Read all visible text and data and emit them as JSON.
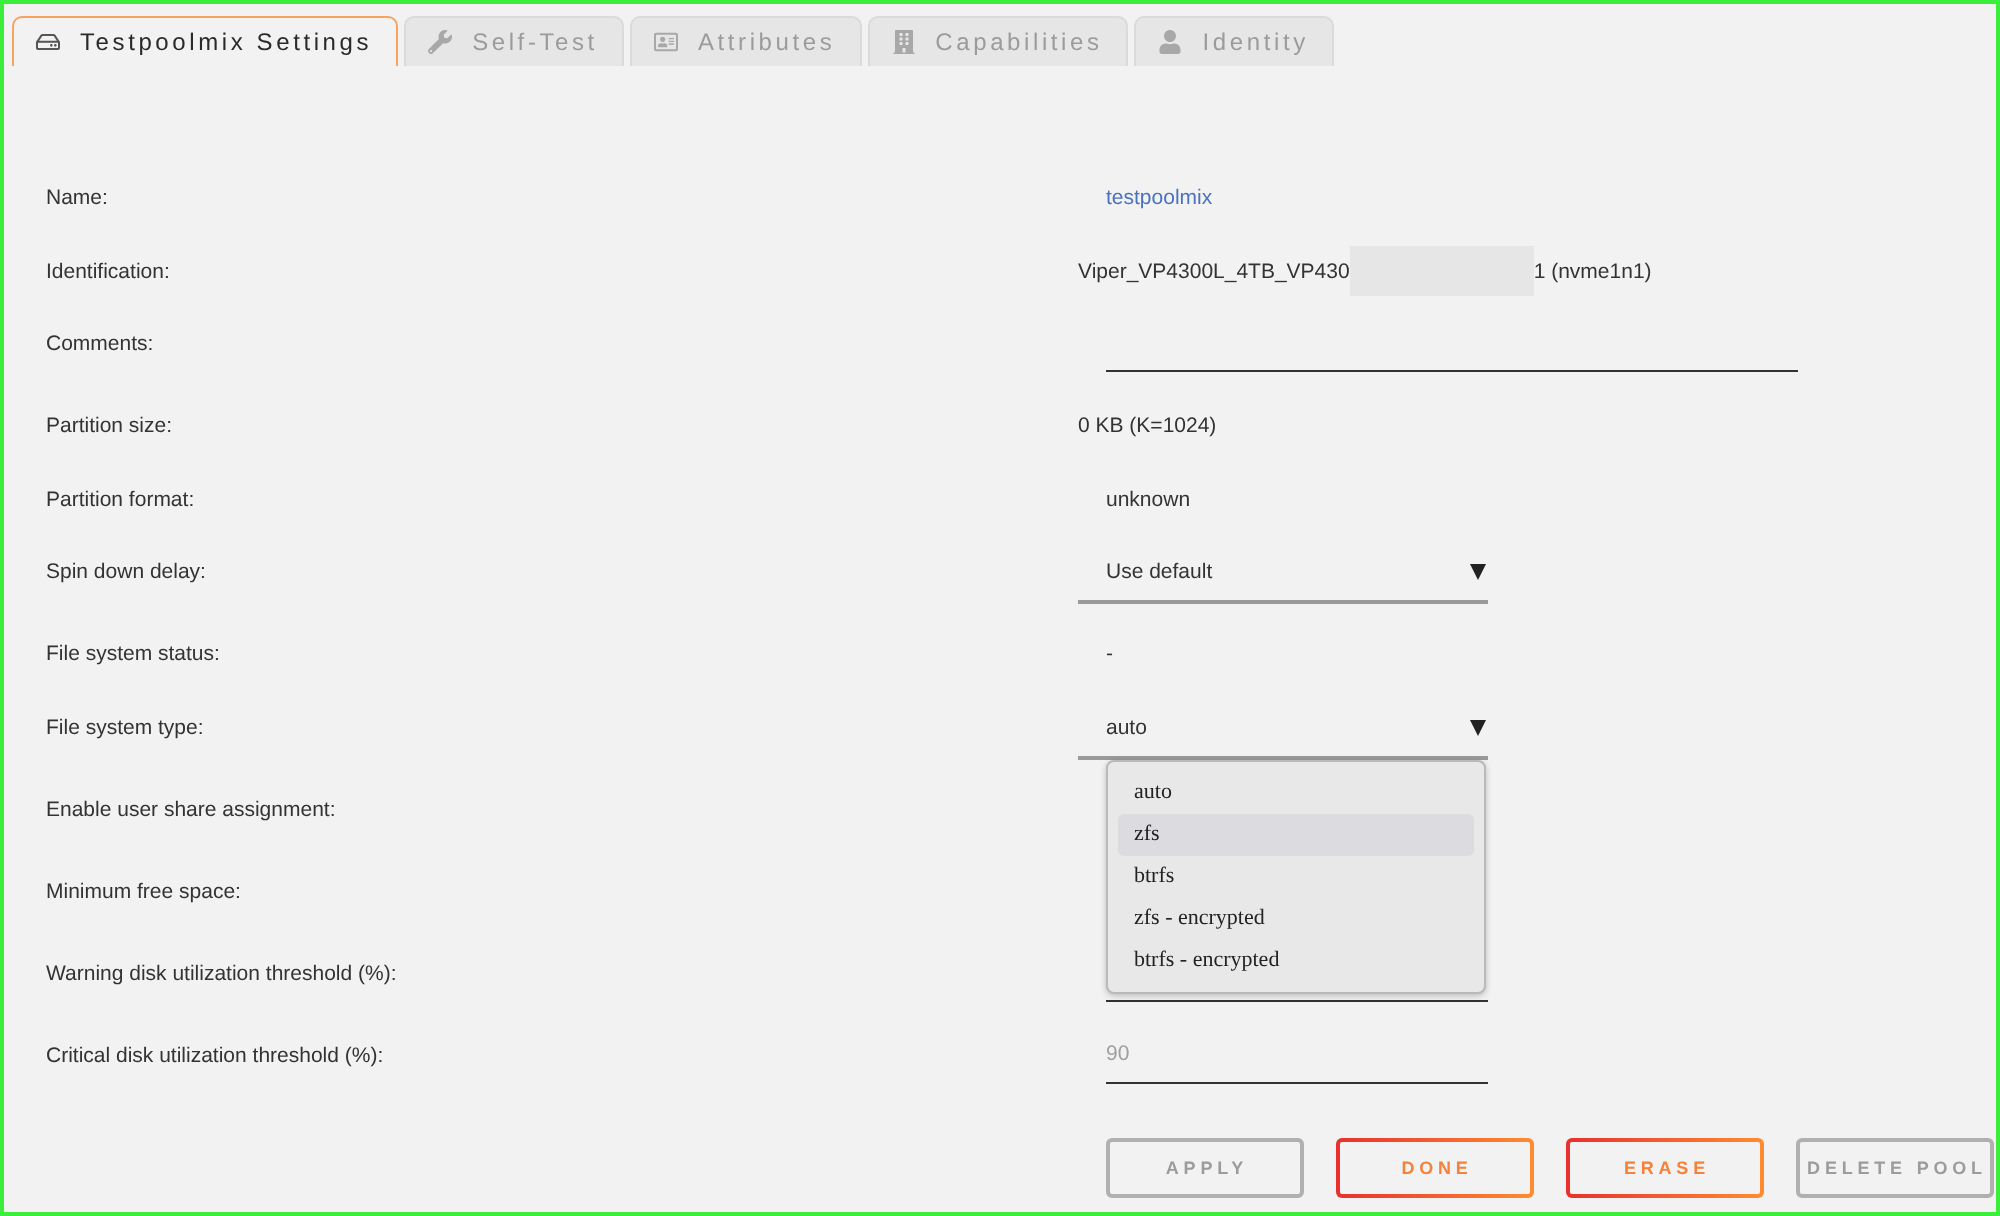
{
  "tabs": [
    {
      "label": "Testpoolmix Settings",
      "selected": true
    },
    {
      "label": "Self-Test",
      "selected": false
    },
    {
      "label": "Attributes",
      "selected": false
    },
    {
      "label": "Capabilities",
      "selected": false
    },
    {
      "label": "Identity",
      "selected": false
    }
  ],
  "fields": [
    {
      "label": "Name:",
      "kind": "link",
      "value": "testpoolmix"
    },
    {
      "label": "Identification:",
      "kind": "identifier",
      "value": "Viper_VP4300L_4TB_VP430",
      "suffix": "1 (nvme1n1)",
      "redacted": true
    },
    {
      "label": "Comments:",
      "kind": "input"
    },
    {
      "label": "Partition size:",
      "kind": "text",
      "value": "0 KB (K=1024)"
    },
    {
      "label": "Partition format:",
      "kind": "status",
      "value": "unknown"
    },
    {
      "label": "Spin down delay:",
      "kind": "select",
      "value": "Use default"
    },
    {
      "label": "File system status:",
      "kind": "status",
      "value": "-"
    },
    {
      "label": "File system type:",
      "kind": "select",
      "value": "auto",
      "expanded": true,
      "options": [
        {
          "label": "auto",
          "highlighted": false
        },
        {
          "label": "zfs",
          "highlighted": true
        },
        {
          "label": "btrfs",
          "highlighted": false
        },
        {
          "label": "zfs - encrypted",
          "highlighted": false
        },
        {
          "label": "btrfs - encrypted",
          "highlighted": false
        }
      ]
    },
    {
      "label": "Enable user share assignment:"
    },
    {
      "label": "Minimum free space:"
    },
    {
      "label": "Warning disk utilization threshold (%):",
      "kind": "number"
    },
    {
      "label": "Critical disk utilization threshold (%):",
      "kind": "number",
      "placeholder": "90"
    }
  ],
  "buttons": [
    {
      "label": "APPLY",
      "disabled": true
    },
    {
      "label": "DONE",
      "disabled": false
    },
    {
      "label": "ERASE",
      "disabled": false
    },
    {
      "label": "DELETE POOL",
      "disabled": true
    }
  ]
}
